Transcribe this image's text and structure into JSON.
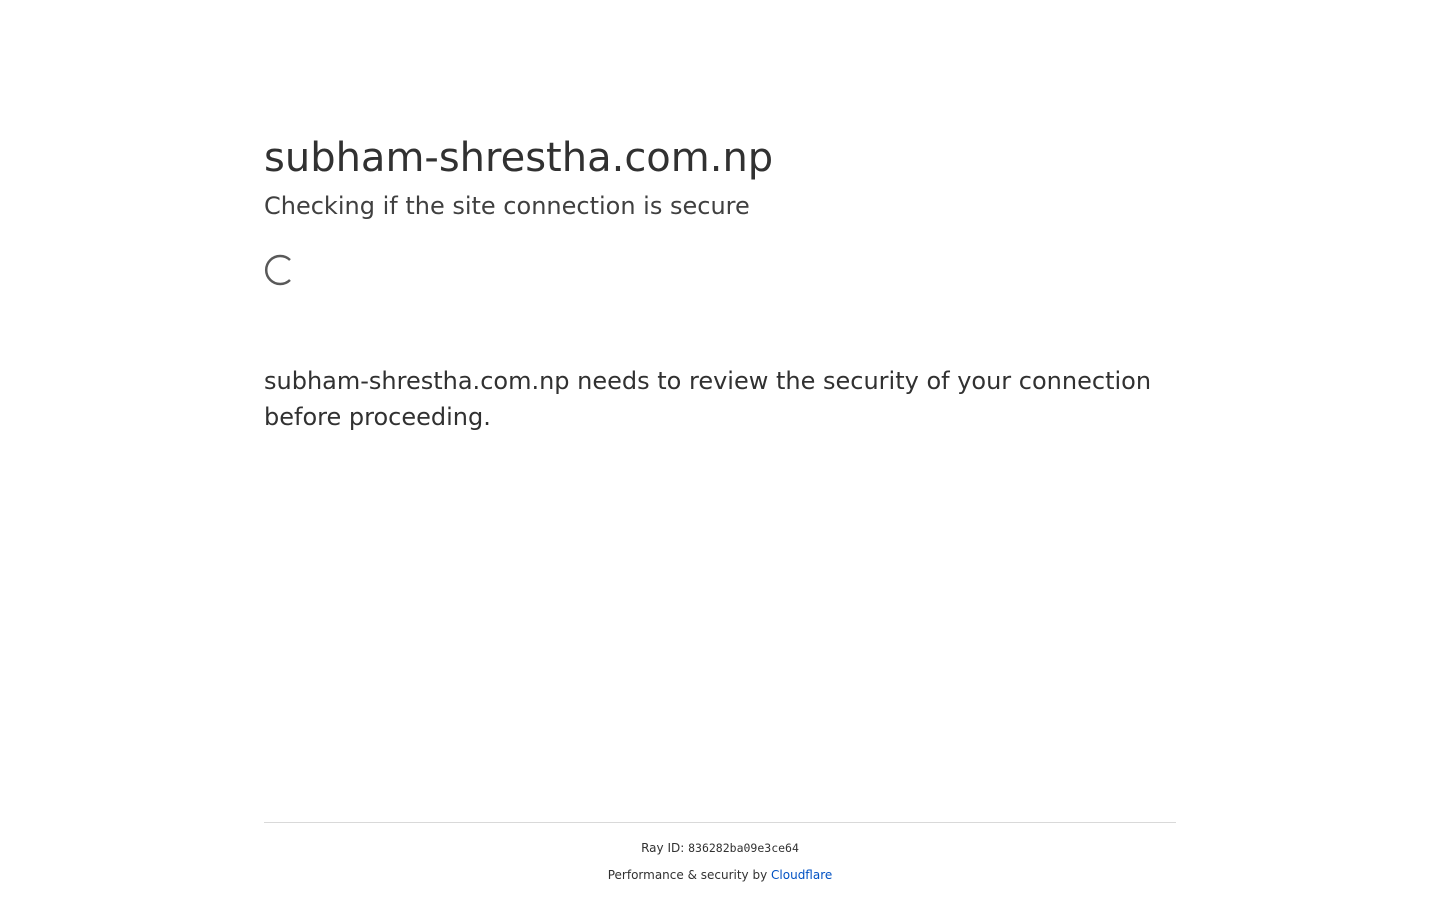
{
  "header": {
    "site_title": "subham-shrestha.com.np",
    "subtitle": "Checking if the site connection is secure"
  },
  "main": {
    "spinner_icon": "loading-spinner-icon",
    "message": "subham-shrestha.com.np needs to review the security of your connection before proceeding."
  },
  "footer": {
    "ray_label": "Ray ID:",
    "ray_id": "836282ba09e3ce64",
    "perf_label": "Performance & security by",
    "cloudflare_link": "Cloudflare"
  },
  "colors": {
    "text": "#313131",
    "link": "#0051c3",
    "divider": "#d9d9d9",
    "background": "#ffffff"
  }
}
